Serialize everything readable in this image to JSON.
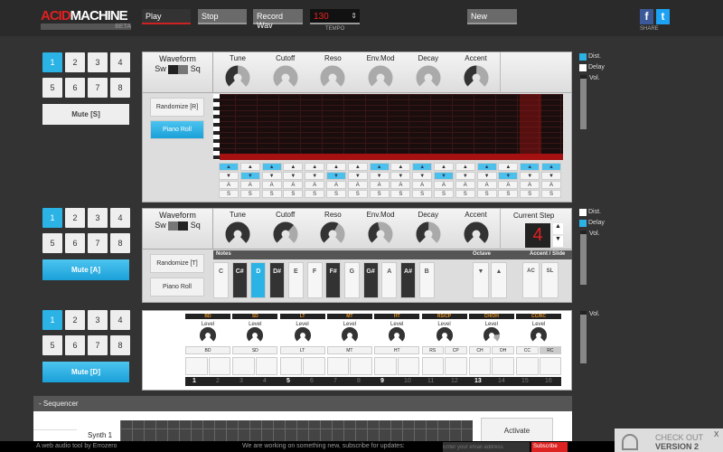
{
  "header": {
    "logo_acid": "ACID",
    "logo_machine": "MACHINE",
    "logo_beta": "BETA",
    "play": "Play",
    "stop": "Stop",
    "record": "Record Wav",
    "tempo_value": "130",
    "tempo_label": "TEMPO",
    "new": "New",
    "facebook": "f",
    "twitter": "t",
    "share_label": "SHARE"
  },
  "synth1": {
    "patterns": [
      "1",
      "2",
      "3",
      "4",
      "5",
      "6",
      "7",
      "8"
    ],
    "active_pattern": 0,
    "mute": "Mute [S]",
    "mute_on": false,
    "waveform": {
      "label": "Waveform",
      "left": "Sw",
      "right": "Sq"
    },
    "knobs": [
      {
        "label": "Tune",
        "value": 0.5
      },
      {
        "label": "Cutoff",
        "value": 0
      },
      {
        "label": "Reso",
        "value": 0
      },
      {
        "label": "Env.Mod",
        "value": 0
      },
      {
        "label": "Decay",
        "value": 0
      },
      {
        "label": "Accent",
        "value": 0.5
      }
    ],
    "randomize": "Randomize [R]",
    "piano_roll": "Piano Roll",
    "up_active": [
      1,
      3,
      8,
      10,
      13,
      15,
      16
    ],
    "down_active": [
      2,
      6,
      11,
      14
    ],
    "accent_label": "A",
    "slide_label": "S",
    "up_glyph": "▲",
    "down_glyph": "▼",
    "dist": {
      "label": "Dist.",
      "checked": true
    },
    "delay": {
      "label": "Delay",
      "checked": false
    },
    "vol_label": "Vol."
  },
  "synth2": {
    "patterns": [
      "1",
      "2",
      "3",
      "4",
      "5",
      "6",
      "7",
      "8"
    ],
    "active_pattern": 0,
    "mute": "Mute [A]",
    "mute_on": true,
    "waveform": {
      "label": "Waveform",
      "left": "Sw",
      "right": "Sq"
    },
    "knobs": [
      {
        "label": "Tune",
        "value": 1
      },
      {
        "label": "Cutoff",
        "value": 0.65
      },
      {
        "label": "Reso",
        "value": 0.6
      },
      {
        "label": "Env.Mod",
        "value": 0.45
      },
      {
        "label": "Decay",
        "value": 0.5
      },
      {
        "label": "Accent",
        "value": 1
      }
    ],
    "current_step_label": "Current Step",
    "current_step": "4",
    "notes_label": "Notes",
    "octave_label": "Octave",
    "accent_slide_label": "Accent / Slide",
    "keys": [
      {
        "n": "C",
        "b": false
      },
      {
        "n": "C#",
        "b": true
      },
      {
        "n": "D",
        "b": false
      },
      {
        "n": "D#",
        "b": true
      },
      {
        "n": "E",
        "b": false
      },
      {
        "n": "F",
        "b": false
      },
      {
        "n": "F#",
        "b": true
      },
      {
        "n": "G",
        "b": false
      },
      {
        "n": "G#",
        "b": true
      },
      {
        "n": "A",
        "b": false
      },
      {
        "n": "A#",
        "b": true
      },
      {
        "n": "B",
        "b": false
      }
    ],
    "active_key": "D",
    "octave_down": "▼",
    "octave_up": "▲",
    "ac": "AC",
    "sl": "SL",
    "randomize": "Randomize [T]",
    "piano_roll": "Piano Roll",
    "dist": {
      "label": "Dist.",
      "checked": false
    },
    "delay": {
      "label": "Delay",
      "checked": true
    },
    "vol_label": "Vol."
  },
  "drums": {
    "patterns": [
      "1",
      "2",
      "3",
      "4",
      "5",
      "6",
      "7",
      "8"
    ],
    "active_pattern": 0,
    "mute": "Mute [D]",
    "mute_on": true,
    "level_label": "Level",
    "groups": [
      {
        "name": "BD",
        "btns": [
          "BD"
        ],
        "level": 1
      },
      {
        "name": "SD",
        "btns": [
          "SD"
        ],
        "level": 1
      },
      {
        "name": "LT",
        "btns": [
          "LT"
        ],
        "level": 1
      },
      {
        "name": "MT",
        "btns": [
          "MT"
        ],
        "level": 1
      },
      {
        "name": "HT",
        "btns": [
          "HT"
        ],
        "level": 1
      },
      {
        "name": "RS/CP",
        "btns": [
          "RS",
          "CP"
        ],
        "level": 1
      },
      {
        "name": "CH/OH",
        "btns": [
          "CH",
          "OH"
        ],
        "level": 0.8
      },
      {
        "name": "CC/RC",
        "btns": [
          "CC",
          "RC"
        ],
        "level": 1
      }
    ],
    "selected_btn": "RC",
    "steps": [
      "1",
      "2",
      "3",
      "4",
      "5",
      "6",
      "7",
      "8",
      "9",
      "10",
      "11",
      "12",
      "13",
      "14",
      "15",
      "16"
    ],
    "vol_label": "Vol."
  },
  "sequencer": {
    "title": "- Sequencer",
    "row_label": "Synth 1",
    "activate": "Activate"
  },
  "footer": {
    "credit": "A web audio tool by Errozero",
    "subscribe_text": "We are working on something new, subscribe for updates:",
    "email_placeholder": "Enter your email address",
    "subscribe": "Subscribe"
  },
  "promo": {
    "line1": "CHECK OUT",
    "line2": "VERSION 2",
    "close": "X"
  },
  "colors": {
    "accent": "#2bb3e6",
    "red": "#e02020"
  }
}
